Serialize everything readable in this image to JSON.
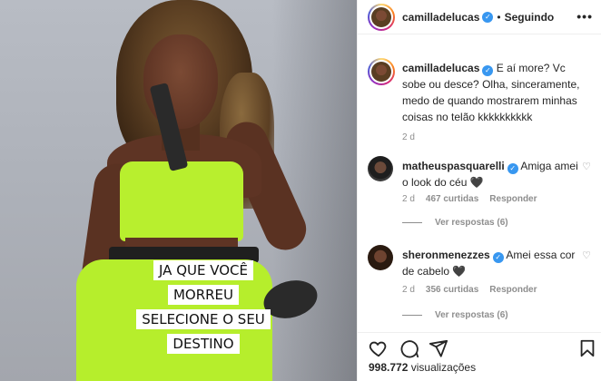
{
  "media": {
    "caption_lines": [
      "JA QUE VOCÊ MORREU",
      "SELECIONE O SEU",
      "DESTINO"
    ]
  },
  "header": {
    "username": "camilladelucas",
    "separator": "•",
    "follow_status": "Seguindo",
    "more": "•••"
  },
  "post_caption": {
    "username": "camilladelucas",
    "text": "E aí more? Vc sobe ou desce? Olha, sinceramente, medo de quando mostrarem minhas coisas no telão kkkkkkkkkk",
    "time": "2 d"
  },
  "comments": [
    {
      "username": "matheuspasquarelli",
      "text": "Amiga amei o look do céu 🖤",
      "time": "2 d",
      "likes": "467 curtidas",
      "reply": "Responder",
      "view_replies": "Ver respostas (6)"
    },
    {
      "username": "sheronmenezzes",
      "text": "Amei essa cor de cabelo 🖤",
      "time": "2 d",
      "likes": "356 curtidas",
      "reply": "Responder",
      "view_replies": "Ver respostas (6)"
    }
  ],
  "actions": {
    "icons": [
      "heart-icon",
      "comment-icon",
      "share-icon",
      "bookmark-icon"
    ]
  },
  "views": {
    "count": "998.772",
    "label": "visualizações"
  },
  "colors": {
    "verified": "#3897f0",
    "muted": "#8e8e8e",
    "text": "#262626"
  }
}
